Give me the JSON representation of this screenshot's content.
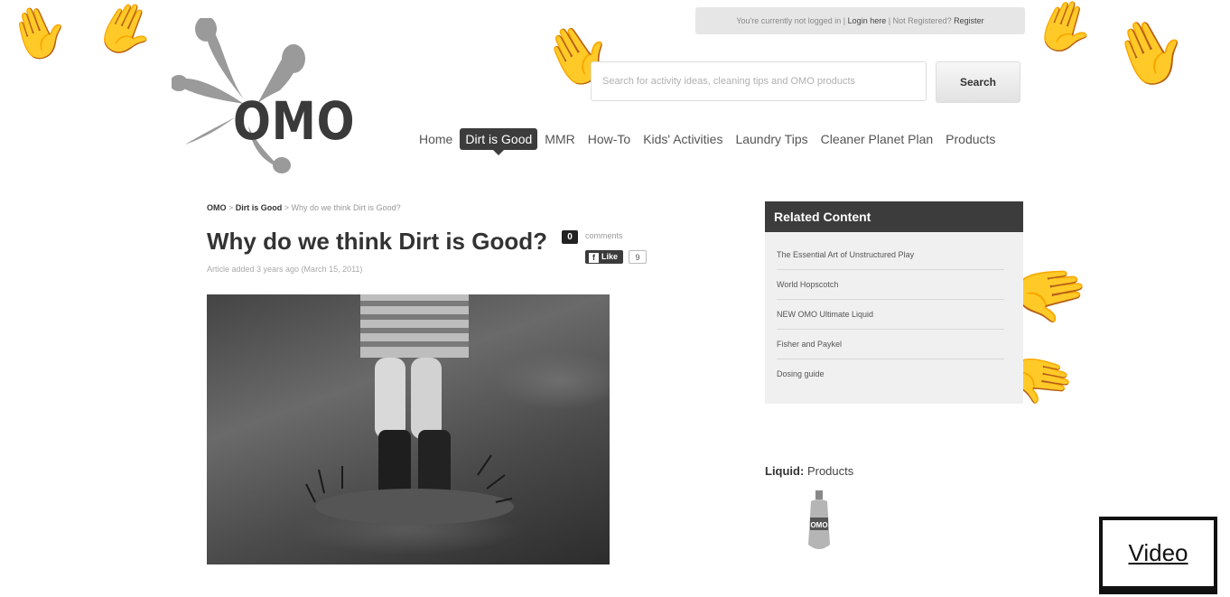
{
  "header": {
    "login_bar": {
      "prefix": "You're currently not logged in |",
      "login_link": "Login here",
      "middle": "| Not Registered?",
      "register_link": "Register"
    },
    "logo_text": "OMO",
    "search": {
      "placeholder": "Search for activity ideas, cleaning tips and OMO products",
      "button_label": "Search"
    }
  },
  "nav": {
    "items": [
      {
        "label": "Home",
        "active": false
      },
      {
        "label": "Dirt is Good",
        "active": true
      },
      {
        "label": "MMR",
        "active": false
      },
      {
        "label": "How-To",
        "active": false
      },
      {
        "label": "Kids' Activities",
        "active": false
      },
      {
        "label": "Laundry Tips",
        "active": false
      },
      {
        "label": "Cleaner Planet Plan",
        "active": false
      },
      {
        "label": "Products",
        "active": false
      }
    ]
  },
  "breadcrumb": {
    "root": "OMO",
    "sep1": " > ",
    "section": "Dirt is Good",
    "sep2": " > ",
    "current": "Why do we think Dirt is Good?"
  },
  "article": {
    "title": "Why do we think Dirt is Good?",
    "comments_count": "0",
    "comments_label": "comments",
    "like_label": "Like",
    "like_icon": "f",
    "like_count": "9",
    "meta": "Article added 3 years ago (March 15, 2011)"
  },
  "related": {
    "heading": "Related Content",
    "items": [
      "The Essential Art of Unstructured Play",
      "World Hopscotch",
      "NEW OMO Ultimate Liquid",
      "Fisher and Paykel",
      "Dosing guide"
    ]
  },
  "products": {
    "category": "Liquid:",
    "label": "Products",
    "bottle_label": "OMO"
  },
  "video": {
    "label": "Video"
  },
  "colors": {
    "dark": "#3c3c3c",
    "panel": "#f0f0f0"
  }
}
